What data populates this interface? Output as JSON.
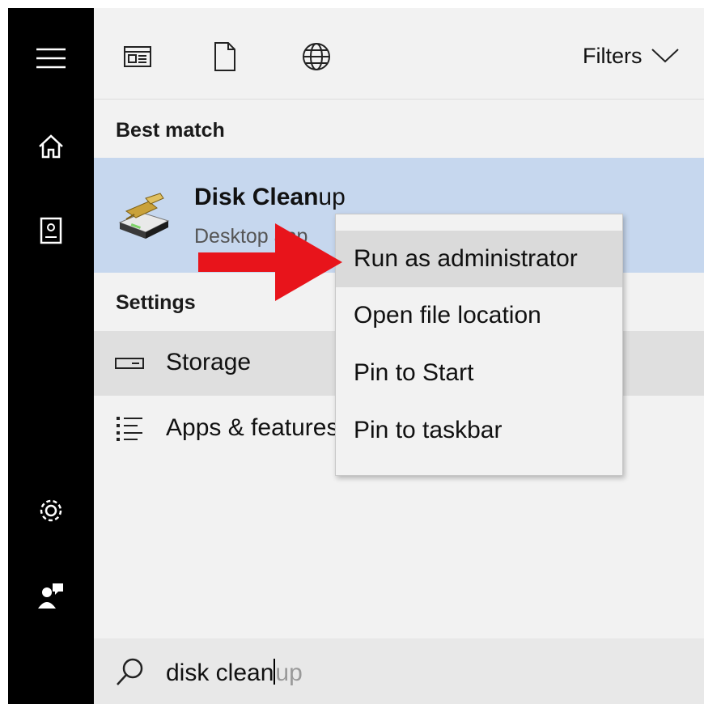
{
  "toolbar": {
    "filters_label": "Filters"
  },
  "sections": {
    "best_match": "Best match",
    "settings": "Settings"
  },
  "best_match": {
    "title_bold": "Disk Clean",
    "title_rest": "up",
    "subtitle": "Desktop app"
  },
  "settings_items": [
    {
      "label": "Storage",
      "icon": "storage-drive-icon"
    },
    {
      "label": "Apps & features",
      "icon": "apps-list-icon"
    }
  ],
  "context_menu": {
    "items": [
      {
        "label": "Run as administrator",
        "highlighted": true
      },
      {
        "label": "Open file location"
      },
      {
        "label": "Pin to Start"
      },
      {
        "label": "Pin to taskbar"
      }
    ]
  },
  "search": {
    "typed": "disk clean",
    "suggestion": "up"
  },
  "colors": {
    "rail": "#000000",
    "selected_row": "#c6d7ee",
    "menu_highlight": "#dadada",
    "annotation_arrow": "#e8141b"
  },
  "icons": {
    "rail": [
      "hamburger-menu-icon",
      "home-icon",
      "notebook-icon",
      "settings-gear-icon",
      "feedback-person-icon"
    ],
    "toolbar": [
      "apps-scope-icon",
      "documents-scope-icon",
      "web-scope-icon",
      "chevron-down-icon"
    ]
  }
}
